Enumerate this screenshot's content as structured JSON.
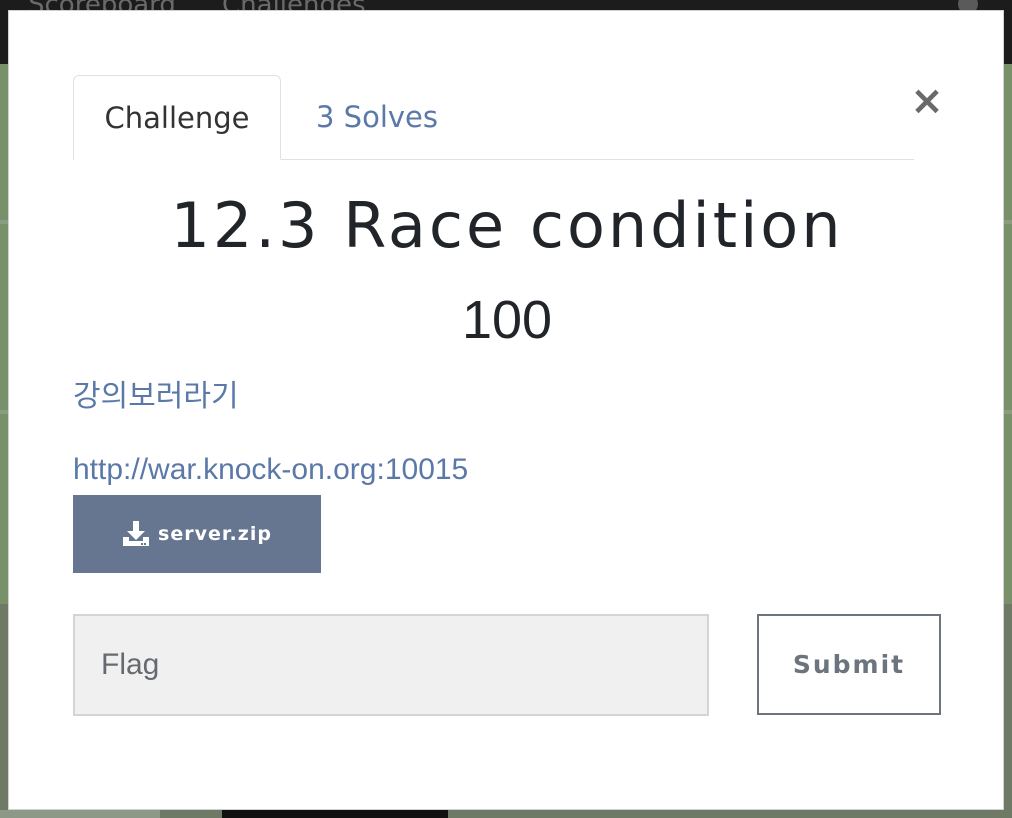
{
  "background_nav": {
    "links": [
      "Scoreboard",
      "Challenges"
    ]
  },
  "modal": {
    "tabs": [
      {
        "label": "Challenge",
        "active": true
      },
      {
        "label": "3 Solves",
        "active": false
      }
    ],
    "close_label": "×",
    "challenge": {
      "name": "12.3 Race condition",
      "value": "100",
      "description_link": "강의보러라기",
      "connection_url": "http://war.knock-on.org:10015",
      "file": {
        "name": "server.zip",
        "icon": "download-icon"
      }
    },
    "flag_input": {
      "value": "",
      "placeholder": "Flag"
    },
    "submit_label": "Submit"
  },
  "colors": {
    "link": "#5b79a8",
    "file_button": "#667691",
    "submit_border": "#6c757d",
    "title_text": "#212529"
  }
}
